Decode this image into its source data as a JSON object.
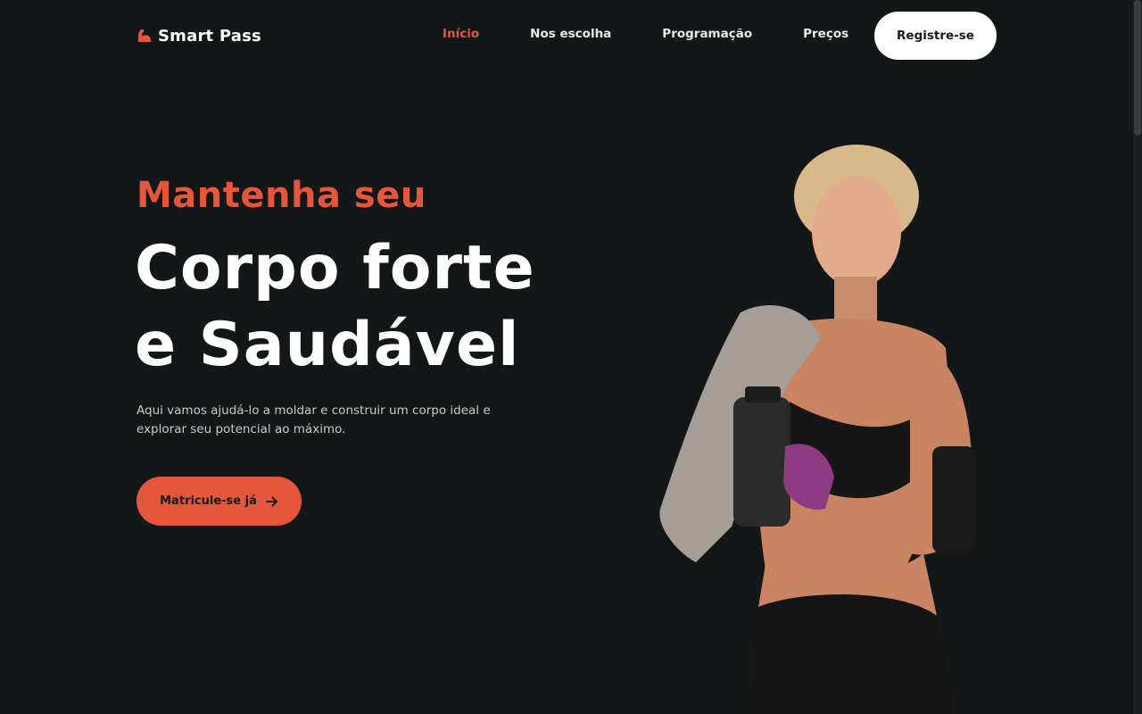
{
  "brand": {
    "name": "Smart Pass",
    "logo_icon": "flexed-arm-icon",
    "accent_color": "#e4573a"
  },
  "nav": {
    "items": [
      {
        "label": "Início",
        "active": true
      },
      {
        "label": "Nos escolha",
        "active": false
      },
      {
        "label": "Programação",
        "active": false
      },
      {
        "label": "Preços",
        "active": false
      }
    ],
    "register_label": "Registre-se"
  },
  "hero": {
    "kicker": "Mantenha seu",
    "title_line1": "Corpo forte",
    "title_line2": "e Saudável",
    "description": "Aqui vamos ajudá-lo a moldar e construir um corpo ideal e explorar seu potencial ao máximo.",
    "cta_label": "Matricule-se já",
    "cta_icon": "arrow-right-icon"
  },
  "colors": {
    "background": "#141718",
    "accent": "#e4573a",
    "text": "#ffffff"
  }
}
